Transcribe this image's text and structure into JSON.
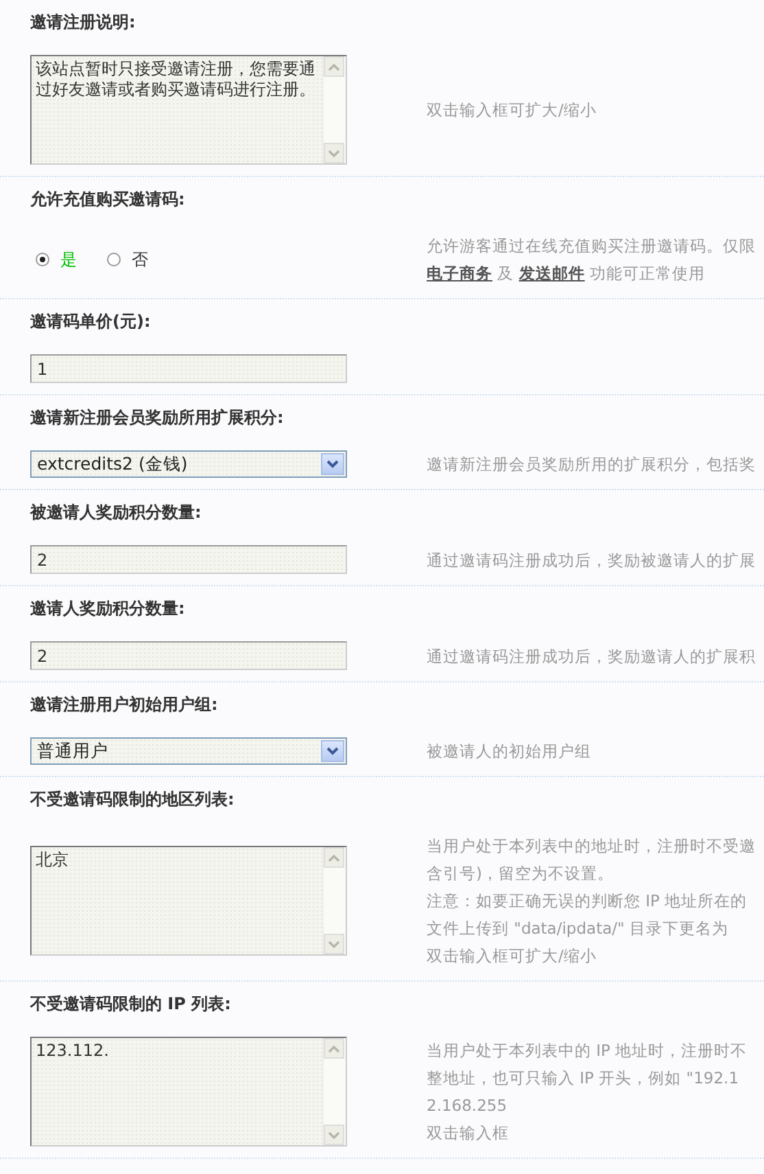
{
  "settings": [
    {
      "label": "邀请注册说明:",
      "control": {
        "kind": "textarea",
        "value": "该站点暂时只接受邀请注册，您需要通过好友邀请或者购买邀请码进行注册。"
      },
      "description": [
        {
          "kind": "plain",
          "text": "双击输入框可扩大/缩小"
        }
      ]
    },
    {
      "label": "允许充值购买邀请码:",
      "control": {
        "kind": "radio",
        "options": [
          {
            "label": "是",
            "selected": true
          },
          {
            "label": "否",
            "selected": false
          }
        ]
      },
      "description": [
        {
          "kind": "plain",
          "text": "允许游客通过在线充值购买注册邀请码。仅限"
        },
        {
          "kind": "links",
          "segments": [
            {
              "kind": "link",
              "text": "电子商务"
            },
            {
              "kind": "text",
              "text": " 及 "
            },
            {
              "kind": "link",
              "text": "发送邮件"
            },
            {
              "kind": "text",
              "text": " 功能可正常使用"
            }
          ]
        }
      ]
    },
    {
      "label": "邀请码单价(元):",
      "control": {
        "kind": "text",
        "value": "1"
      }
    },
    {
      "label": "邀请新注册会员奖励所用扩展积分:",
      "control": {
        "kind": "select",
        "value": "extcredits2 (金钱)"
      },
      "description": [
        {
          "kind": "plain",
          "text": "邀请新注册会员奖励所用的扩展积分，包括奖"
        }
      ]
    },
    {
      "label": "被邀请人奖励积分数量:",
      "control": {
        "kind": "text",
        "value": "2"
      },
      "description": [
        {
          "kind": "plain",
          "text": "通过邀请码注册成功后，奖励被邀请人的扩展"
        }
      ]
    },
    {
      "label": "邀请人奖励积分数量:",
      "control": {
        "kind": "text",
        "value": "2"
      },
      "description": [
        {
          "kind": "plain",
          "text": "通过邀请码注册成功后，奖励邀请人的扩展积"
        }
      ]
    },
    {
      "label": "邀请注册用户初始用户组:",
      "control": {
        "kind": "select",
        "value": "普通用户"
      },
      "description": [
        {
          "kind": "plain",
          "text": "被邀请人的初始用户组"
        }
      ]
    },
    {
      "label": "不受邀请码限制的地区列表:",
      "control": {
        "kind": "textarea",
        "value": "北京"
      },
      "description": [
        {
          "kind": "plain",
          "text": "当用户处于本列表中的地址时，注册时不受邀"
        },
        {
          "kind": "plain",
          "text": "含引号)，留空为不设置。"
        },
        {
          "kind": "plain",
          "text": "注意：如要正确无误的判断您 IP 地址所在的"
        },
        {
          "kind": "plain",
          "text": "文件上传到 \"data/ipdata/\" 目录下更名为"
        },
        {
          "kind": "plain",
          "text": "双击输入框可扩大/缩小"
        }
      ]
    },
    {
      "label": "不受邀请码限制的 IP 列表:",
      "control": {
        "kind": "textarea",
        "value": "123.112."
      },
      "description": [
        {
          "kind": "plain",
          "text": "当用户处于本列表中的 IP 地址时，注册时不"
        },
        {
          "kind": "plain",
          "text": "整地址，也可只输入 IP 开头，例如 \"192.1"
        },
        {
          "kind": "plain",
          "text": "2.168.255"
        },
        {
          "kind": "plain",
          "text": "双击输入框"
        }
      ]
    }
  ]
}
